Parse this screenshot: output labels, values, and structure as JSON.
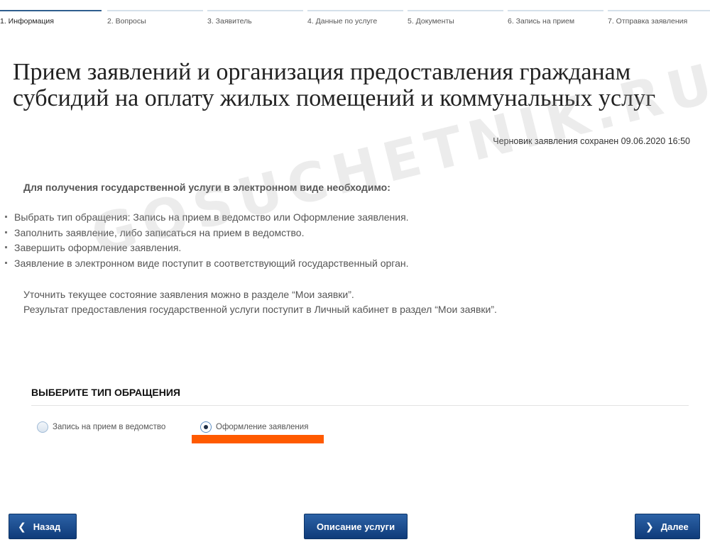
{
  "steps": [
    {
      "label": "1. Информация",
      "active": true
    },
    {
      "label": "2. Вопросы",
      "active": false
    },
    {
      "label": "3. Заявитель",
      "active": false
    },
    {
      "label": "4. Данные по услуге",
      "active": false
    },
    {
      "label": "5. Документы",
      "active": false
    },
    {
      "label": "6. Запись на прием",
      "active": false
    },
    {
      "label": "7. Отправка заявления",
      "active": false
    }
  ],
  "page": {
    "title": "Прием заявлений и организация предоставления гражданам субсидий на оплату жилых помещений и коммунальных услуг",
    "draft_status": "Черновик заявления сохранен 09.06.2020 16:50"
  },
  "info": {
    "intro": "Для получения государственной услуги в электронном виде необходимо:",
    "bullets": [
      "Выбрать тип обращения: Запись на прием в ведомство или Оформление заявления.",
      "Заполнить заявление, либо записаться на прием в ведомство.",
      "Завершить оформление заявления.",
      "Заявление в электронном виде поступит в соответствующий государственный орган."
    ],
    "status_line": "Уточнить текущее состояние заявления можно в разделе “Мои заявки”.",
    "result_line": "Результат предоставления государственной услуги поступит в Личный кабинет в раздел “Мои заявки”."
  },
  "watermark": "GOSUCHETNIK.RU",
  "request_type": {
    "heading": "ВЫБЕРИТЕ ТИП ОБРАЩЕНИЯ",
    "options": [
      {
        "label": "Запись на прием в ведомство",
        "selected": false
      },
      {
        "label": "Оформление заявления",
        "selected": true
      }
    ]
  },
  "buttons": {
    "back": "Назад",
    "description": "Описание услуги",
    "next": "Далее"
  },
  "colors": {
    "accent": "#1c4f8f",
    "highlight": "#ff5a00",
    "step_active": "#2f5e8e",
    "step_inactive": "#d5e0ea"
  }
}
